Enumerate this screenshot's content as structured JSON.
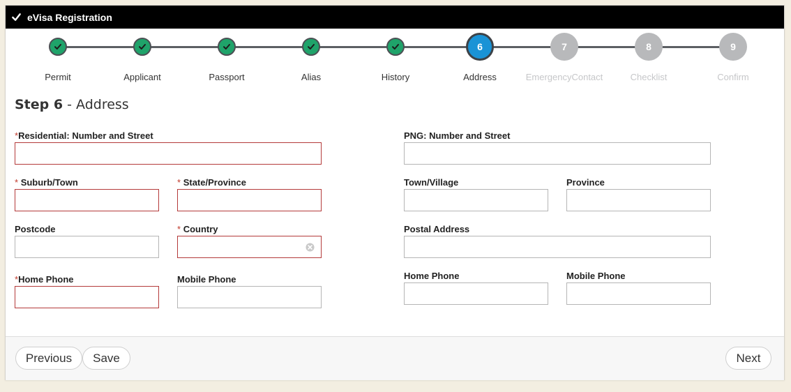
{
  "window": {
    "title": "eVisa Registration"
  },
  "stepper": {
    "steps": [
      {
        "number": "1",
        "label": "Permit",
        "state": "complete"
      },
      {
        "number": "2",
        "label": "Applicant",
        "state": "complete"
      },
      {
        "number": "3",
        "label": "Passport",
        "state": "complete"
      },
      {
        "number": "4",
        "label": "Alias",
        "state": "complete"
      },
      {
        "number": "5",
        "label": "History",
        "state": "complete"
      },
      {
        "number": "6",
        "label": "Address",
        "state": "active"
      },
      {
        "number": "7",
        "label": "EmergencyContact",
        "state": "pending"
      },
      {
        "number": "8",
        "label": "Checklist",
        "state": "pending"
      },
      {
        "number": "9",
        "label": "Confirm",
        "state": "pending"
      }
    ]
  },
  "heading": {
    "step": "Step 6",
    "separator": " - ",
    "name": "Address"
  },
  "residential": {
    "street_label": "Residential: Number and Street",
    "suburb_label": "Suburb/Town",
    "state_label": "State/Province",
    "postcode_label": "Postcode",
    "country_label": "Country",
    "home_phone_label": "Home Phone",
    "mobile_phone_label": "Mobile Phone",
    "required_mark": "*"
  },
  "png": {
    "street_label": "PNG: Number and Street",
    "town_label": "Town/Village",
    "province_label": "Province",
    "postal_label": "Postal Address",
    "home_phone_label": "Home Phone",
    "mobile_phone_label": "Mobile Phone"
  },
  "footer": {
    "previous_label": "Previous",
    "save_label": "Save",
    "next_label": "Next"
  },
  "colors": {
    "complete": "#1fa36a",
    "active": "#1a93d6",
    "pending": "#b8b9bb",
    "required_border": "#b43a3a",
    "required_mark": "#c0392b"
  }
}
